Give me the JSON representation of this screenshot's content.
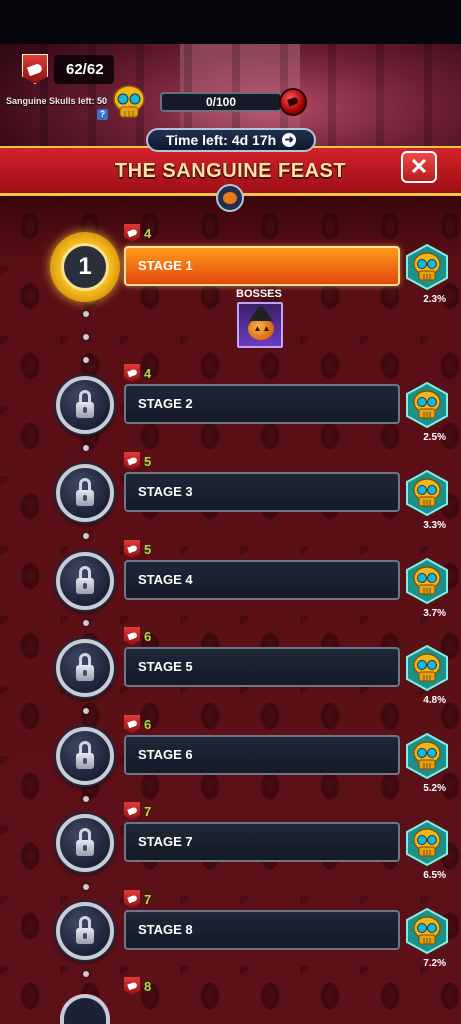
{
  "header": {
    "energy": "62/62",
    "skulls_left_label": "Sanguine Skulls left:",
    "skulls_left_value": "50",
    "help": "?",
    "progress_text": "0/100",
    "progress_fraction": 0,
    "time_left_label": "Time left:",
    "time_left_value": "4d 17h",
    "title": "THE SANGUINE FEAST",
    "close": "✕"
  },
  "bosses_label": "BOSSES",
  "stages": [
    {
      "name": "STAGE 1",
      "cost": "4",
      "reward_pct": "2.3%",
      "status": "active",
      "number": "1"
    },
    {
      "name": "STAGE 2",
      "cost": "4",
      "reward_pct": "2.5%",
      "status": "locked"
    },
    {
      "name": "STAGE 3",
      "cost": "5",
      "reward_pct": "3.3%",
      "status": "locked"
    },
    {
      "name": "STAGE 4",
      "cost": "5",
      "reward_pct": "3.7%",
      "status": "locked"
    },
    {
      "name": "STAGE 5",
      "cost": "6",
      "reward_pct": "4.8%",
      "status": "locked"
    },
    {
      "name": "STAGE 6",
      "cost": "6",
      "reward_pct": "5.2%",
      "status": "locked"
    },
    {
      "name": "STAGE 7",
      "cost": "7",
      "reward_pct": "6.5%",
      "status": "locked"
    },
    {
      "name": "STAGE 8",
      "cost": "7",
      "reward_pct": "7.2%",
      "status": "locked"
    },
    {
      "name": "",
      "cost": "8",
      "reward_pct": "",
      "status": "locked"
    }
  ],
  "icons": {
    "energy": "energy-shield-icon",
    "skull": "golden-skull-icon",
    "lock": "lock-icon",
    "boss": "pumpkin-boss-portrait"
  },
  "colors": {
    "banner": "#c81c22",
    "active_stage": "#f07010",
    "cost_text": "#9fe04a"
  }
}
